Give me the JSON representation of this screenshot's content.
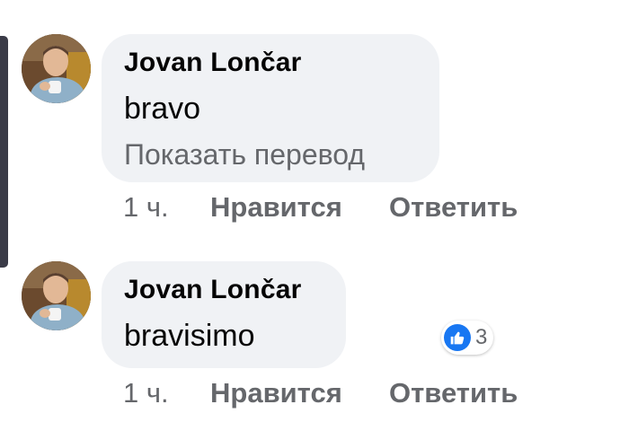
{
  "comments": [
    {
      "author": "Jovan Lončar",
      "text": "bravo",
      "translate_label": "Показать перевод",
      "time": "1 ч.",
      "like_label": "Нравится",
      "reply_label": "Ответить"
    },
    {
      "author": "Jovan Lončar",
      "text": "bravisimo",
      "time": "1 ч.",
      "like_label": "Нравится",
      "reply_label": "Ответить",
      "reactions": {
        "icon": "like-icon",
        "count": "3"
      }
    }
  ],
  "colors": {
    "bubble": "#f0f2f5",
    "secondary_text": "#65676b",
    "like_blue": "#1877f2",
    "thread_line": "#3a3b47"
  }
}
